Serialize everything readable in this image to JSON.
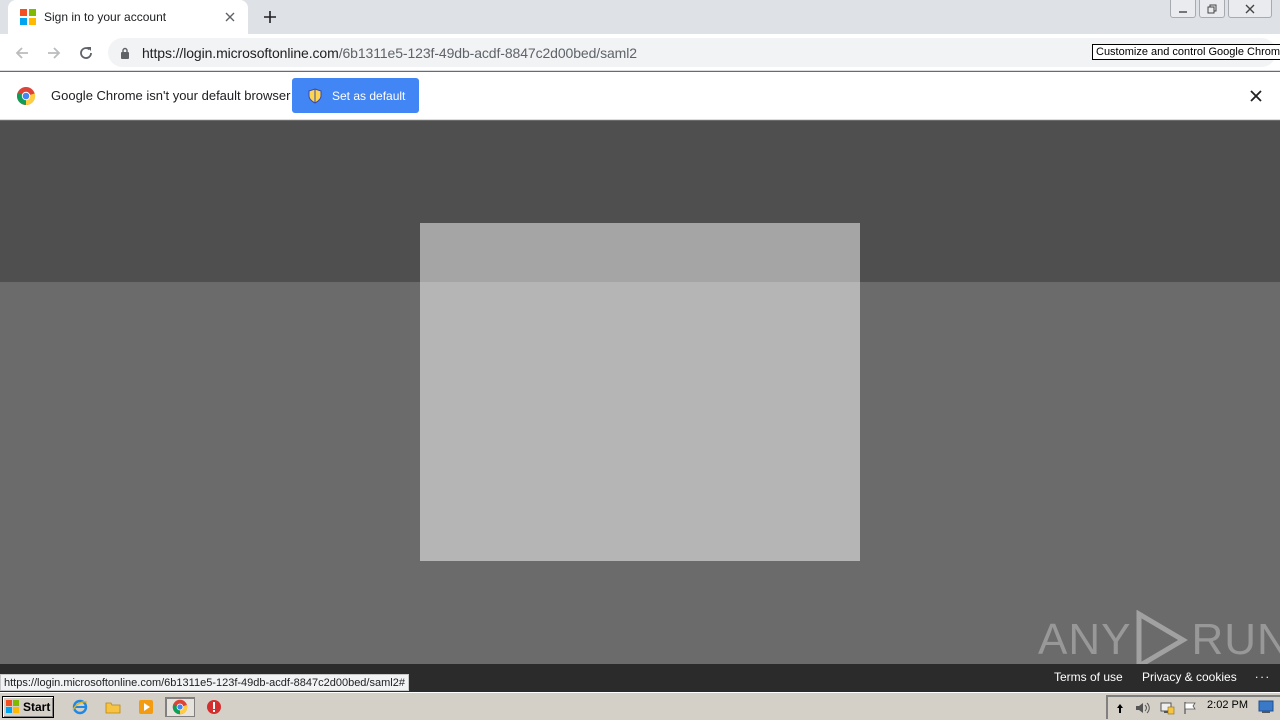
{
  "browser": {
    "tab_title": "Sign in to your account",
    "url_host": "https://login.microsoftonline.com",
    "url_path": "/6b1311e5-123f-49db-acdf-8847c2d00bed/saml2",
    "tooltip": "Customize and control Google Chrome"
  },
  "infobar": {
    "message": "Google Chrome isn't your default browser",
    "button_label": "Set as default"
  },
  "footer": {
    "terms_label": "Terms of use",
    "privacy_label": "Privacy & cookies",
    "more_label": "..."
  },
  "status": {
    "hover_url": "https://login.microsoftonline.com/6b1311e5-123f-49db-acdf-8847c2d00bed/saml2#"
  },
  "watermark": {
    "left": "ANY",
    "right": "RUN"
  },
  "taskbar": {
    "start_label": "Start",
    "time": "2:02 PM"
  },
  "colors": {
    "accent": "#4285f4",
    "overlay_dark": "#4f4f4f",
    "overlay": "#6b6b6b",
    "modal": "#b5b5b5"
  },
  "icons": [
    "microsoft-logo-icon",
    "close-icon",
    "plus-icon",
    "back-icon",
    "forward-icon",
    "reload-icon",
    "lock-icon",
    "chrome-logo-icon",
    "shield-icon"
  ]
}
